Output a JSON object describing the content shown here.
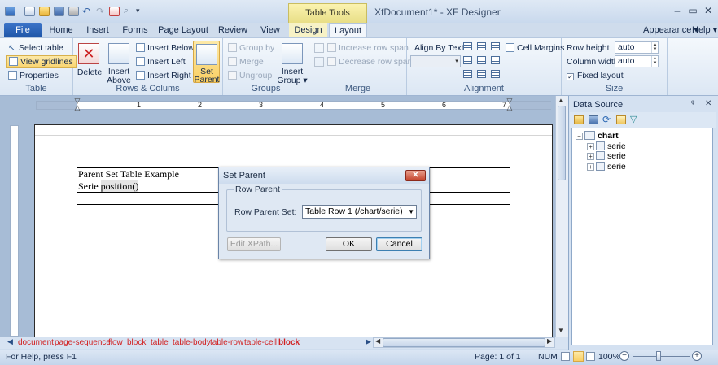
{
  "titlebar": {
    "context_group": "Table Tools",
    "doc_title": "XfDocument1* - XF Designer",
    "win_min": "–",
    "win_max": "▭",
    "win_close": "✕"
  },
  "tabs": {
    "file": "File",
    "home": "Home",
    "insert": "Insert",
    "forms": "Forms",
    "page_layout": "Page Layout",
    "review": "Review",
    "view": "View",
    "design": "Design",
    "layout": "Layout",
    "appearance": "Appearance ▾",
    "help": "Help ▾"
  },
  "ribbon": {
    "table": {
      "label": "Table",
      "select_table": "Select table",
      "view_gridlines": "View gridlines",
      "properties": "Properties"
    },
    "rows_cols": {
      "label": "Rows & Colums",
      "delete": "Delete",
      "insert_above": "Insert Above",
      "insert_below": "Insert Below",
      "insert_left": "Insert Left",
      "insert_right": "Insert Right",
      "set_parent": "Set Parent"
    },
    "groups": {
      "label": "Groups",
      "group_by": "Group by",
      "merge": "Merge",
      "ungroup": "Ungroup",
      "insert_group": "Insert Group ▾"
    },
    "merge": {
      "label": "Merge",
      "increase_row_span": "Increase row span",
      "decrease_row_span": "Decrease row span"
    },
    "alignment": {
      "label": "Alignment",
      "align_by_text": "Align By Text",
      "cell_margins": "Cell Margins"
    },
    "size": {
      "label": "Size",
      "row_height_label": "Row height",
      "row_height_value": "auto",
      "column_width_label": "Column width",
      "column_width_value": "auto",
      "fixed_layout": "Fixed layout"
    }
  },
  "ruler": {
    "numbers": [
      "1",
      "2",
      "3",
      "4",
      "5",
      "6",
      "7"
    ]
  },
  "document": {
    "row1": "Parent Set Table Example",
    "row2_prefix": "Serie ",
    "row2_field": "position()"
  },
  "dialog": {
    "title": "Set Parent",
    "close": "✕",
    "group_label": "Row Parent",
    "row_parent_set_label": "Row Parent Set:",
    "row_parent_set_value": "Table Row 1 (/chart/serie)",
    "edit_xpath": "Edit XPath...",
    "ok": "OK",
    "cancel": "Cancel"
  },
  "data_source": {
    "title": "Data Source",
    "pin": "ᵠ",
    "close": "✕",
    "root": "chart",
    "children": [
      "serie",
      "serie",
      "serie"
    ]
  },
  "breadcrumbs": [
    "document",
    "page-sequence",
    "flow",
    "block",
    "table",
    "table-body",
    "table-row",
    "table-cell",
    "block"
  ],
  "status": {
    "help": "For Help, press F1",
    "page": "Page: 1 of 1",
    "num": "NUM",
    "zoom": "100%"
  },
  "colors": {
    "accent": "#1f56a8",
    "breadcrumb": "#d21f1f",
    "context_tab": "#f7f2c6"
  }
}
